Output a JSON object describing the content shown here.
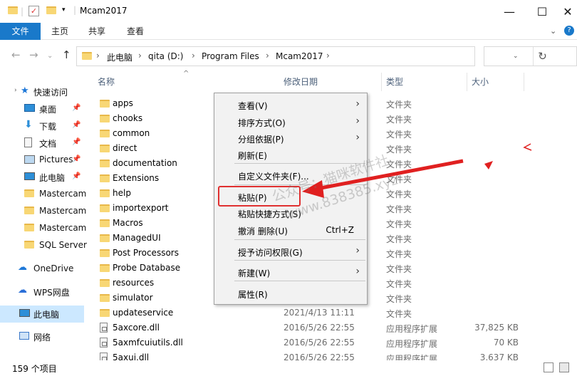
{
  "window": {
    "title": "Mcam2017"
  },
  "ribbon": {
    "tabs": [
      "文件",
      "主页",
      "共享",
      "查看"
    ]
  },
  "address": {
    "path": [
      "此电脑",
      "qita (D:)",
      "Program Files",
      "Mcam2017"
    ]
  },
  "nav": {
    "items": [
      {
        "label": "快速访问",
        "icon": "star-icon",
        "pinned": false
      },
      {
        "label": "桌面",
        "icon": "desktop-icon",
        "pinned": true
      },
      {
        "label": "下载",
        "icon": "download-icon",
        "pinned": true
      },
      {
        "label": "文档",
        "icon": "document-icon",
        "pinned": true
      },
      {
        "label": "Pictures",
        "icon": "pictures-icon",
        "pinned": true
      },
      {
        "label": "此电脑",
        "icon": "computer-icon",
        "pinned": true
      },
      {
        "label": "Mastercam",
        "icon": "folder-icon",
        "pinned": false
      },
      {
        "label": "Mastercam",
        "icon": "folder-icon",
        "pinned": false
      },
      {
        "label": "Mastercam",
        "icon": "folder-icon",
        "pinned": false
      },
      {
        "label": "SQL Server",
        "icon": "folder-icon",
        "pinned": false
      },
      {
        "label": "OneDrive",
        "icon": "cloud-icon",
        "pinned": false
      },
      {
        "label": "WPS网盘",
        "icon": "cloud-icon",
        "pinned": false
      },
      {
        "label": "此电脑",
        "icon": "computer-icon",
        "pinned": false
      },
      {
        "label": "网络",
        "icon": "network-icon",
        "pinned": false
      }
    ]
  },
  "columns": {
    "name": "名称",
    "date": "修改日期",
    "type": "类型",
    "size": "大小"
  },
  "files": [
    {
      "name": "apps",
      "date": "",
      "type": "文件夹",
      "size": "",
      "kind": "folder"
    },
    {
      "name": "chooks",
      "date": "",
      "type": "文件夹",
      "size": "",
      "kind": "folder"
    },
    {
      "name": "common",
      "date": "",
      "type": "文件夹",
      "size": "",
      "kind": "folder"
    },
    {
      "name": "direct",
      "date": "",
      "type": "文件夹",
      "size": "",
      "kind": "folder"
    },
    {
      "name": "documentation",
      "date": "",
      "type": "文件夹",
      "size": "",
      "kind": "folder"
    },
    {
      "name": "Extensions",
      "date": "",
      "type": "文件夹",
      "size": "",
      "kind": "folder"
    },
    {
      "name": "help",
      "date": "",
      "type": "文件夹",
      "size": "",
      "kind": "folder"
    },
    {
      "name": "importexport",
      "date": "",
      "type": "文件夹",
      "size": "",
      "kind": "folder"
    },
    {
      "name": "Macros",
      "date": "",
      "type": "文件夹",
      "size": "",
      "kind": "folder"
    },
    {
      "name": "ManagedUI",
      "date": "",
      "type": "文件夹",
      "size": "",
      "kind": "folder"
    },
    {
      "name": "Post Processors",
      "date": "",
      "type": "文件夹",
      "size": "",
      "kind": "folder"
    },
    {
      "name": "Probe Database",
      "date": "",
      "type": "文件夹",
      "size": "",
      "kind": "folder"
    },
    {
      "name": "resources",
      "date": "",
      "type": "文件夹",
      "size": "",
      "kind": "folder"
    },
    {
      "name": "simulator",
      "date": "",
      "type": "文件夹",
      "size": "",
      "kind": "folder"
    },
    {
      "name": "updateservice",
      "date": "2021/4/13 11:11",
      "type": "文件夹",
      "size": "",
      "kind": "folder"
    },
    {
      "name": "5axcore.dll",
      "date": "2016/5/26 22:55",
      "type": "应用程序扩展",
      "size": "37,825 KB",
      "kind": "dll"
    },
    {
      "name": "5axmfcuiutils.dll",
      "date": "2016/5/26 22:55",
      "type": "应用程序扩展",
      "size": "70 KB",
      "kind": "dll"
    },
    {
      "name": "5axui.dll",
      "date": "2016/5/26 22:55",
      "type": "应用程序扩展",
      "size": "3,637 KB",
      "kind": "dll"
    }
  ],
  "status": {
    "count": "159 个项目"
  },
  "context_menu": {
    "items": [
      {
        "label": "查看(V)",
        "submenu": true,
        "shortcut": ""
      },
      {
        "label": "排序方式(O)",
        "submenu": true,
        "shortcut": ""
      },
      {
        "label": "分组依据(P)",
        "submenu": true,
        "shortcut": ""
      },
      {
        "label": "刷新(E)",
        "submenu": false,
        "shortcut": ""
      },
      {
        "label": "自定义文件夹(F)...",
        "submenu": false,
        "shortcut": ""
      },
      {
        "label": "粘贴(P)",
        "submenu": false,
        "shortcut": ""
      },
      {
        "label": "粘贴快捷方式(S)",
        "submenu": false,
        "shortcut": ""
      },
      {
        "label": "撤消 删除(U)",
        "submenu": false,
        "shortcut": "Ctrl+Z"
      },
      {
        "label": "授予访问权限(G)",
        "submenu": true,
        "shortcut": ""
      },
      {
        "label": "新建(W)",
        "submenu": true,
        "shortcut": ""
      },
      {
        "label": "属性(R)",
        "submenu": false,
        "shortcut": ""
      }
    ]
  },
  "watermark": {
    "line1": "公众号：猫咪软件社",
    "line2": "www.838385.xyz"
  },
  "colors": {
    "accent": "#1979ca",
    "highlight": "#e03030",
    "selected": "#cce8ff"
  }
}
